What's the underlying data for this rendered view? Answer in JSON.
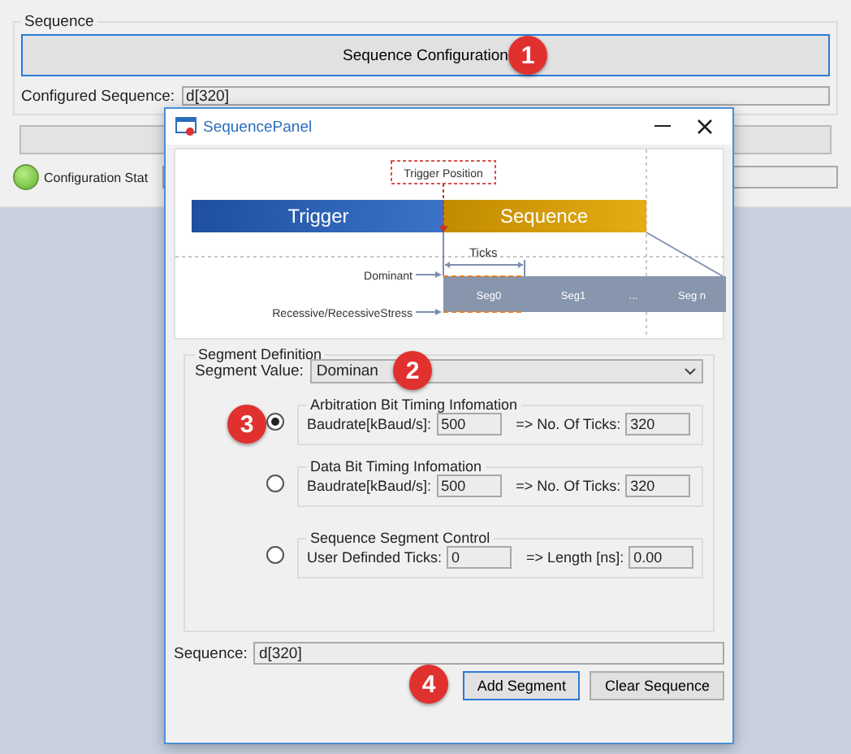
{
  "main": {
    "group_title": "Sequence",
    "config_button": {
      "label": "Sequence Configuration",
      "focused": true,
      "callout": "1"
    },
    "configured_label": "Configured Sequence:",
    "configured_value": "d[320]",
    "status_label": "Configuration Stat"
  },
  "dialog": {
    "title": "SequencePanel",
    "diagram": {
      "trigger_position": "Trigger Position",
      "trigger": "Trigger",
      "sequence": "Sequence",
      "ticks": "Ticks",
      "dominant": "Dominant",
      "recessive": "Recessive/RecessiveStress",
      "segments": [
        "Seg0",
        "Seg1",
        "...",
        "Seg n"
      ]
    },
    "segment": {
      "group_title": "Segment Definition",
      "value_label": "Segment Value:",
      "value": "Dominan",
      "callout": "2",
      "options": [
        {
          "title": "Arbitration Bit Timing Infomation",
          "selected": true,
          "callout": "3",
          "fields": [
            {
              "label": "Baudrate[kBaud/s]:",
              "value": "500"
            },
            {
              "label": "=> No. Of Ticks:",
              "value": "320"
            }
          ]
        },
        {
          "title": "Data Bit Timing Infomation",
          "selected": false,
          "fields": [
            {
              "label": "Baudrate[kBaud/s]:",
              "value": "500"
            },
            {
              "label": "=> No. Of Ticks:",
              "value": "320"
            }
          ]
        },
        {
          "title": "Sequence Segment Control",
          "selected": false,
          "fields": [
            {
              "label": "User Definded Ticks:",
              "value": "0"
            },
            {
              "label": "=> Length [ns]:",
              "value": "0.00"
            }
          ]
        }
      ]
    },
    "sequence_label": "Sequence:",
    "sequence_value": "d[320]",
    "buttons_callout": "4",
    "buttons": [
      {
        "label": "Add Segment",
        "focused": true
      },
      {
        "label": "Clear Sequence",
        "focused": false
      }
    ]
  }
}
